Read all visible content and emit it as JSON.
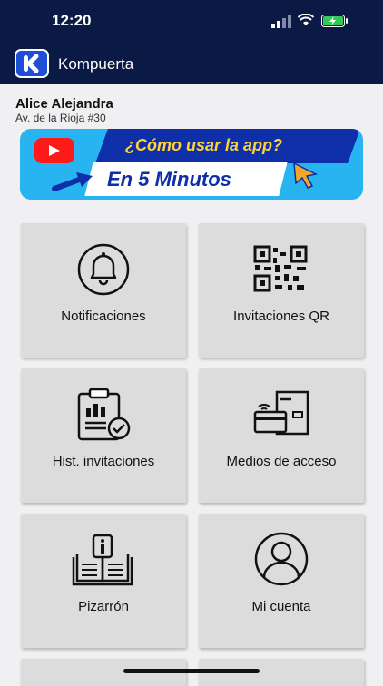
{
  "status_bar": {
    "time": "12:20"
  },
  "header": {
    "app_name": "Kompuerta"
  },
  "user": {
    "name": "Alice Alejandra",
    "address": "Av. de la Rioja #30"
  },
  "banner": {
    "question": "¿Cómo usar la app?",
    "headline": "En 5 Minutos"
  },
  "tiles": [
    {
      "label": "Notificaciones",
      "icon": "bell-icon"
    },
    {
      "label": "Invitaciones QR",
      "icon": "qr-code-icon"
    },
    {
      "label": "Hist. invitaciones",
      "icon": "clipboard-chart-icon"
    },
    {
      "label": "Medios de acceso",
      "icon": "access-card-icon"
    },
    {
      "label": "Pizarrón",
      "icon": "info-board-icon"
    },
    {
      "label": "Mi cuenta",
      "icon": "user-account-icon"
    }
  ],
  "colors": {
    "header_bg": "#0b1a45",
    "banner_blue": "#27b4f0",
    "tile_bg": "#dcdcdc"
  }
}
